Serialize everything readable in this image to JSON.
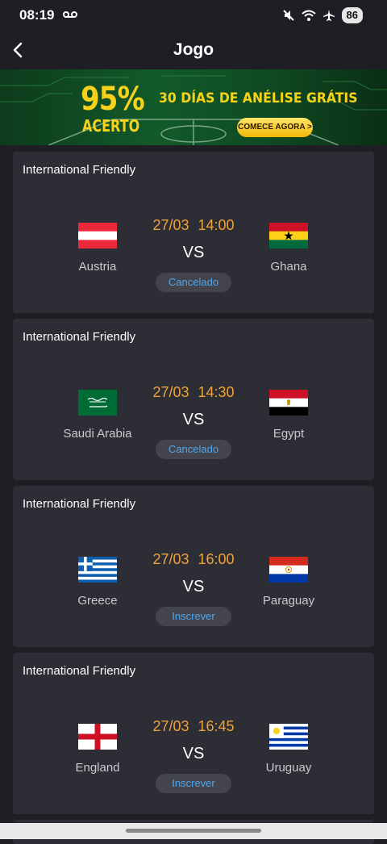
{
  "status_bar": {
    "time": "08:19",
    "battery": "86"
  },
  "header": {
    "title": "Jogo"
  },
  "banner": {
    "percent": "95%",
    "accuracy": "ACERTO",
    "headline": "30 DÍAS DE ANÉLISE GRÁTIS",
    "cta": "COMECE AGORA >"
  },
  "matches": [
    {
      "league": "International Friendly",
      "date": "27/03",
      "time": "14:00",
      "vs": "VS",
      "home": "Austria",
      "away": "Ghana",
      "status": "Cancelado"
    },
    {
      "league": "International Friendly",
      "date": "27/03",
      "time": "14:30",
      "vs": "VS",
      "home": "Saudi Arabia",
      "away": "Egypt",
      "status": "Cancelado"
    },
    {
      "league": "International Friendly",
      "date": "27/03",
      "time": "16:00",
      "vs": "VS",
      "home": "Greece",
      "away": "Paraguay",
      "status": "Inscrever"
    },
    {
      "league": "International Friendly",
      "date": "27/03",
      "time": "16:45",
      "vs": "VS",
      "home": "England",
      "away": "Uruguay",
      "status": "Inscrever"
    }
  ],
  "colors": {
    "accent_time": "#f0a33a",
    "status_text": "#4ea8f0",
    "card_bg": "#2d2d35",
    "page_bg": "#1e1e24"
  }
}
